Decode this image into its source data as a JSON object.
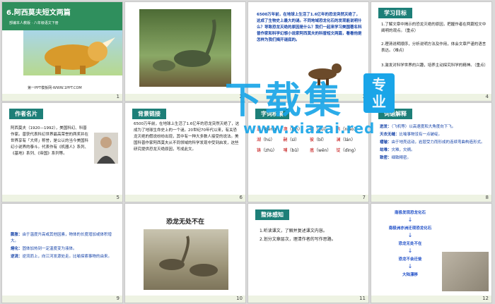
{
  "slides": [
    {
      "num": "1",
      "title": "6.阿西莫夫短文两篇",
      "subtitle": "部编本人教版 · 八年级语文下册",
      "footer": "第一PPT模板网-WWW.1PPT.COM"
    },
    {
      "num": "2"
    },
    {
      "num": "3",
      "text": "6500万年前，在地球上生活了1.6亿年的恐龙突然灭绝了，这成了生物史上最大的谜。不同地域恐龙化石的发现能说明什么？导致恐龙灭绝的原因是什么？我们一起来学习美国著名科普作家和科学幻想小说家阿西莫夫的科普短文两篇，看看他是怎样为我们揭开谜底的。"
    },
    {
      "num": "4",
      "tag": "学习目标",
      "items": [
        "1.了解文章中揭示的恐龙灭绝的原因，把握作者在两篇短文中阐明的观点。（重点）",
        "2.理清说明顺序，分析说明方法及作用，体会文章严谨的语言表达。（难点）",
        "3.激发对科学世界的兴趣，培养主动探究科学的精神。（重点）"
      ]
    },
    {
      "num": "5",
      "tag": "作者名片",
      "text": "阿西莫夫（1920—1992），美国科幻、科普作家。曾获代表科幻世界最高荣誉的两奖并在世界享有「大师」称誉，是公认的当今美国科幻小说界的泰斗。代表作有《机器人》系列、《基地》系列、《帝国》系列等。"
    },
    {
      "num": "6",
      "tag": "背景链接",
      "text": "6500万年前，在地球上生活了1.6亿年的恐龙突然灭绝了，这成为了地球生命史上的一个谜。20世纪70年代以来，有关恐龙灭绝的假说纷纷出现，其中有一种大多数人接受的说法。美国科普作家阿西莫夫从不同领域的科学发现中受到启发，这些研究提供恐龙灭绝原因，写成此文。"
    },
    {
      "num": "7",
      "tag": "字词积累",
      "chars": [
        [
          "迸",
          "bèng"
        ],
        [
          "濒",
          "bīn"
        ],
        [
          "归",
          "guī"
        ],
        [
          "鸟",
          "niǎo"
        ],
        [
          "湖",
          "hú"
        ],
        [
          "嗣",
          "sì"
        ],
        [
          "彼",
          "bǐ"
        ],
        [
          "澜",
          "lán"
        ],
        [
          "铸",
          "zhù"
        ],
        [
          "哺",
          "bǔ"
        ],
        [
          "瘟",
          "wēn"
        ],
        [
          "锭",
          "dìng"
        ]
      ]
    },
    {
      "num": "8",
      "tag": "词语解释",
      "defs": [
        [
          "迸发：",
          "（飞机等）以高速度和大角度向下飞。"
        ],
        [
          "天衣无缝：",
          "比喻事物没有一点破绽。"
        ],
        [
          "褶皱：",
          "由于地壳运动，岩层受力而形成的连续弯曲构造形式。"
        ],
        [
          "劫难：",
          "灾难，灾祸。"
        ],
        [
          "致密：",
          "细致精密。"
        ]
      ]
    },
    {
      "num": "9",
      "defs": [
        [
          "膨胀：",
          "由于温度升高或其他因素，物体的长度增加或体积增大。"
        ],
        [
          "熔化：",
          "固体加热到一定温度变为液体。"
        ],
        [
          "逆流：",
          "逆流而上，向江河发源处走。比喻探索事物的由来。"
        ]
      ]
    },
    {
      "num": "10",
      "title": "恐龙无处不在"
    },
    {
      "num": "11",
      "tag": "整体感知",
      "items": [
        "1.听读课文，了解并复述课文内容。",
        "2.划分文章层次，理清作者的写作思路。"
      ]
    },
    {
      "num": "12",
      "flow": [
        "南极发现恐龙化石",
        "南极洲亦洲迁现恐龙化石",
        "恐龙无处不在",
        "恐龙不会迁徙",
        "大陆漂移"
      ]
    }
  ],
  "watermark": {
    "main": "下载集",
    "side": "专业",
    "url": "www.xiazai.red"
  },
  "colors": {
    "teal": "#1d7f78",
    "blue_wm": "#1aa5e8",
    "flow_blue": "#1f4fc7"
  }
}
